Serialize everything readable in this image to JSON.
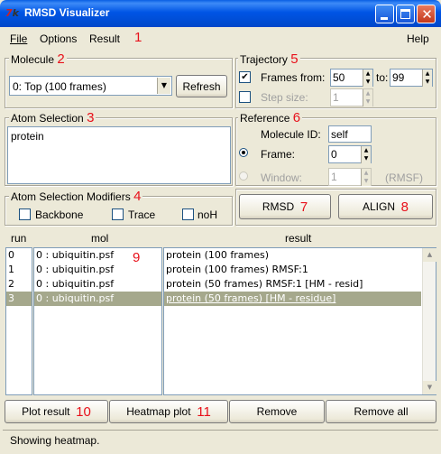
{
  "window": {
    "title": "RMSD Visualizer"
  },
  "menu": {
    "file": "File",
    "options": "Options",
    "result": "Result",
    "help": "Help"
  },
  "annotations": [
    "1",
    "2",
    "3",
    "4",
    "5",
    "6",
    "7",
    "8",
    "9",
    "10",
    "11"
  ],
  "molecule": {
    "legend": "Molecule",
    "selected": "0: Top  (100 frames)",
    "refresh": "Refresh"
  },
  "atom_selection": {
    "legend": "Atom Selection",
    "text": "protein"
  },
  "modifiers": {
    "legend": "Atom Selection Modifiers",
    "backbone": "Backbone",
    "trace": "Trace",
    "noh": "noH"
  },
  "trajectory": {
    "legend": "Trajectory",
    "frames_from_label": "Frames from:",
    "frames_from": "50",
    "to_label": "to:",
    "frames_to": "99",
    "step_label": "Step size:",
    "step": "1"
  },
  "reference": {
    "legend": "Reference",
    "mol_id_label": "Molecule ID:",
    "mol_id": "self",
    "frame_label": "Frame:",
    "frame": "0",
    "window_label": "Window:",
    "window": "1",
    "rmsf": "(RMSF)"
  },
  "actions": {
    "rmsd": "RMSD",
    "align": "ALIGN"
  },
  "table": {
    "headers": {
      "run": "run",
      "mol": "mol",
      "result": "result"
    },
    "runs": [
      "0",
      "1",
      "2",
      "3"
    ],
    "mols": [
      "0 : ubiquitin.psf",
      "0 : ubiquitin.psf",
      "0 : ubiquitin.psf",
      "0 : ubiquitin.psf"
    ],
    "results": [
      "protein (100 frames)",
      "protein (100 frames) RMSF:1",
      "protein (50 frames) RMSF:1 [HM - resid]",
      "protein (50 frames) [HM - residue]"
    ]
  },
  "bottom": {
    "plot": "Plot result",
    "heatmap": "Heatmap plot",
    "remove": "Remove",
    "remove_all": "Remove all"
  },
  "status": "Showing heatmap."
}
